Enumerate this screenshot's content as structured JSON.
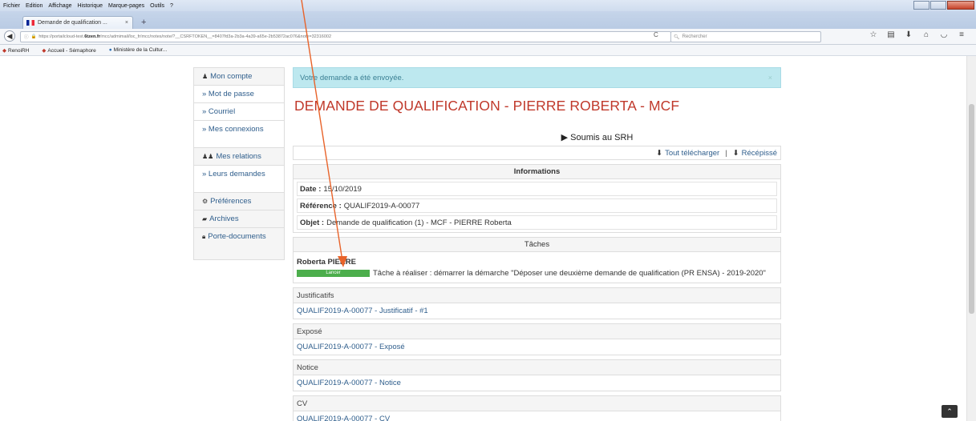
{
  "browser": {
    "menu": [
      "Fichier",
      "Edition",
      "Affichage",
      "Historique",
      "Marque-pages",
      "Outils",
      "?"
    ],
    "tab_title": "Demande de qualification ...",
    "url_prefix": "https://portailcloud-test.",
    "url_host": "6tzen.fr",
    "url_rest": "/mcc/admimail/loc_fr/mcc/notes/note/?__CSRFTOKEN__=8407fd3a-2b3a-4a39-a65e-2b53872ac076&note=32316002",
    "search_placeholder": "Rechercher",
    "bookmarks": [
      "RenoiRH",
      "Accueil - Sémaphore",
      "Ministère de la Cultur..."
    ]
  },
  "sidebar": {
    "items": [
      {
        "label": "Mon compte",
        "icon": "user-icon"
      },
      {
        "label": "» Mot de passe"
      },
      {
        "label": "» Courriel"
      },
      {
        "label": "» Mes connexions"
      },
      {
        "label": "Mes relations",
        "icon": "users-icon"
      },
      {
        "label": "» Leurs demandes"
      },
      {
        "label": "Préférences",
        "icon": "cogs-icon"
      },
      {
        "label": "Archives",
        "icon": "folder-icon"
      },
      {
        "label": "Porte-documents",
        "icon": "lock-icon"
      }
    ]
  },
  "main": {
    "alert": "Votre demande a été envoyée.",
    "title": "DEMANDE DE QUALIFICATION - PIERRE ROBERTA - MCF",
    "status": "Soumis au SRH",
    "download_all": "Tout télécharger",
    "receipt": "Récépissé",
    "info_header": "Informations",
    "date_label": "Date :",
    "date_value": "15/10/2019",
    "ref_label": "Référence :",
    "ref_value": "QUALIF2019-A-00077",
    "object_label": "Objet :",
    "object_value": "Demande de qualification (1) - MCF - PIERRE Roberta",
    "tasks_header": "Tâches",
    "task_person": "Roberta PIERRE",
    "task_button": "Lancer",
    "task_text": "Tâche à réaliser : démarrer la démarche \"Déposer une deuxième demande de qualification (PR ENSA) - 2019-2020\"",
    "documents": [
      {
        "header": "Justificatifs",
        "link": "QUALIF2019-A-00077 - Justificatif - #1"
      },
      {
        "header": "Exposé",
        "link": "QUALIF2019-A-00077 - Exposé"
      },
      {
        "header": "Notice",
        "link": "QUALIF2019-A-00077 - Notice"
      },
      {
        "header": "CV",
        "link": "QUALIF2019-A-00077 - CV"
      }
    ]
  },
  "colors": {
    "accent": "#c0392b",
    "link": "#2f5e8c",
    "alert_bg": "#bde8ef",
    "button": "#4cae4c",
    "annotation": "#e8632a"
  }
}
